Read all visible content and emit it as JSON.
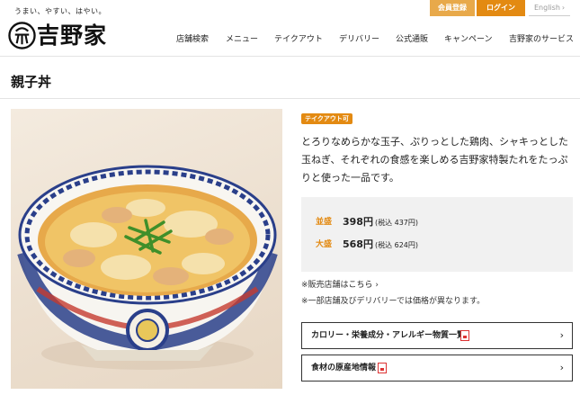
{
  "header": {
    "tagline": "うまい、やすい、はやい。",
    "logo_text": "吉野家",
    "member_button": "会員登録",
    "login_button": "ログイン",
    "english_link": "English",
    "nav": [
      "店舗検索",
      "メニュー",
      "テイクアウト",
      "デリバリー",
      "公式通販",
      "キャンペーン",
      "吉野家のサービス"
    ]
  },
  "page": {
    "title": "親子丼"
  },
  "product": {
    "badge": "テイクアウト可",
    "description": "とろりなめらかな玉子、ぷりっとした鶏肉、シャキっとした玉ねぎ、それぞれの食感を楽しめる吉野家特製たれをたっぷりと使った一品です。",
    "prices": [
      {
        "label": "並盛",
        "price": "398円",
        "tax": "(税込 437円)"
      },
      {
        "label": "大盛",
        "price": "568円",
        "tax": "(税込 624円)"
      }
    ],
    "note_stores_prefix": "※販売店舗は",
    "note_stores_link": "こちら",
    "note_price": "※一部店舗及びデリバリーでは価格が異なります。",
    "buttons": [
      "カロリー・栄養成分・アレルギー物質一覧",
      "食材の原産地情報"
    ]
  },
  "colors": {
    "accent": "#e38a12",
    "accent_light": "#e8a94a",
    "price_bg": "#f1f1f1"
  }
}
